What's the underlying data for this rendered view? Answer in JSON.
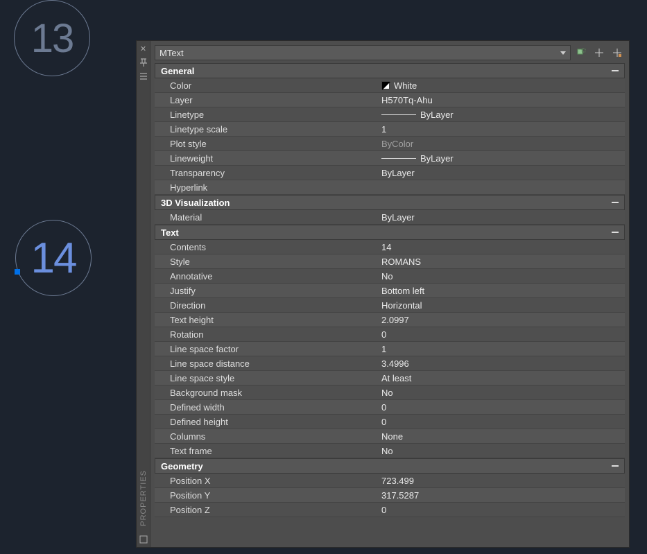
{
  "canvas": {
    "label13": "13",
    "label14": "14"
  },
  "panel": {
    "title": "PROPERTIES",
    "object_type": "MText",
    "sections": {
      "general": {
        "title": "General",
        "color_label": "Color",
        "color_value": "White",
        "layer_label": "Layer",
        "layer_value": "H570Tq-Ahu",
        "linetype_label": "Linetype",
        "linetype_value": "ByLayer",
        "ltscale_label": "Linetype scale",
        "ltscale_value": "1",
        "plotstyle_label": "Plot style",
        "plotstyle_value": "ByColor",
        "lineweight_label": "Lineweight",
        "lineweight_value": "ByLayer",
        "transparency_label": "Transparency",
        "transparency_value": "ByLayer",
        "hyperlink_label": "Hyperlink",
        "hyperlink_value": ""
      },
      "viz3d": {
        "title": "3D Visualization",
        "material_label": "Material",
        "material_value": "ByLayer"
      },
      "text": {
        "title": "Text",
        "contents_label": "Contents",
        "contents_value": "14",
        "style_label": "Style",
        "style_value": "ROMANS",
        "annotative_label": "Annotative",
        "annotative_value": "No",
        "justify_label": "Justify",
        "justify_value": "Bottom left",
        "direction_label": "Direction",
        "direction_value": "Horizontal",
        "textheight_label": "Text height",
        "textheight_value": "2.0997",
        "rotation_label": "Rotation",
        "rotation_value": "0",
        "lsf_label": "Line space factor",
        "lsf_value": "1",
        "lsd_label": "Line space distance",
        "lsd_value": "3.4996",
        "lss_label": "Line space style",
        "lss_value": "At least",
        "bgmask_label": "Background mask",
        "bgmask_value": "No",
        "defwidth_label": "Defined width",
        "defwidth_value": "0",
        "defheight_label": "Defined height",
        "defheight_value": "0",
        "columns_label": "Columns",
        "columns_value": "None",
        "textframe_label": "Text frame",
        "textframe_value": "No"
      },
      "geom": {
        "title": "Geometry",
        "posx_label": "Position X",
        "posx_value": "723.499",
        "posy_label": "Position Y",
        "posy_value": "317.5287",
        "posz_label": "Position Z",
        "posz_value": "0"
      }
    }
  }
}
